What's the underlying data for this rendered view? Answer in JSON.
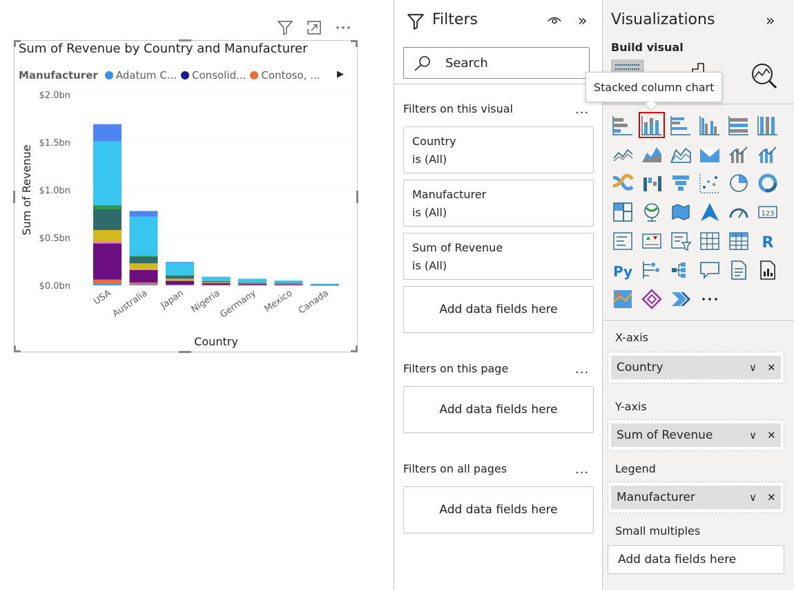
{
  "visual": {
    "title": "Sum of Revenue by Country and Manufacturer",
    "legend_title": "Manufacturer",
    "legend_items": [
      {
        "label": "Adatum C...",
        "color": "#3a8ff0"
      },
      {
        "label": "Consolid...",
        "color": "#1c1a8e"
      },
      {
        "label": "Contoso, ...",
        "color": "#e86c3a"
      }
    ]
  },
  "chart_data": {
    "type": "bar",
    "stacked": true,
    "title": "Sum of Revenue by Country and Manufacturer",
    "xlabel": "Country",
    "ylabel": "Sum of Revenue",
    "categories": [
      "USA",
      "Australia",
      "Japan",
      "Nigeria",
      "Germany",
      "Mexico",
      "Canada"
    ],
    "y_ticks": [
      "$0.0bn",
      "$0.5bn",
      "$1.0bn",
      "$1.5bn",
      "$2.0bn"
    ],
    "ylim": [
      0,
      2.0
    ],
    "units": "bn",
    "grid": true,
    "legend_position": "top-left",
    "series": [
      {
        "name": "Adatum C...",
        "color": "#3a8ff0",
        "values": [
          0.02,
          0.01,
          0.003,
          0.002,
          0.002,
          0.002,
          0.001
        ]
      },
      {
        "name": "",
        "color": "#e86c3a",
        "values": [
          0.04,
          0.02,
          0.005,
          0.003,
          0.003,
          0.003,
          0.001
        ]
      },
      {
        "name": "",
        "color": "#6b0e7f",
        "values": [
          0.38,
          0.13,
          0.04,
          0.02,
          0.015,
          0.01,
          0.002
        ]
      },
      {
        "name": "",
        "color": "#e87ec5",
        "values": [
          0.02,
          0.01,
          0.002,
          0.001,
          0.001,
          0.001,
          0.0
        ]
      },
      {
        "name": "",
        "color": "#d4b81f",
        "values": [
          0.12,
          0.06,
          0.02,
          0.007,
          0.003,
          0.003,
          0.0
        ]
      },
      {
        "name": "",
        "color": "#2f6b6b",
        "values": [
          0.22,
          0.07,
          0.03,
          0.01,
          0.005,
          0.005,
          0.002
        ]
      },
      {
        "name": "",
        "color": "#2c9a3d",
        "values": [
          0.04,
          0.01,
          0.005,
          0.002,
          0.001,
          0.001,
          0.0
        ]
      },
      {
        "name": "",
        "color": "#38c5f0",
        "values": [
          0.67,
          0.41,
          0.13,
          0.04,
          0.04,
          0.025,
          0.01
        ]
      },
      {
        "name": "",
        "color": "#4d86f0",
        "values": [
          0.18,
          0.06,
          0.01,
          0.005,
          0.0,
          0.0,
          0.0
        ]
      }
    ]
  },
  "filters": {
    "title": "Filters",
    "search_placeholder": "Search",
    "visual_section": "Filters on this visual",
    "cards": [
      {
        "name": "Country",
        "state": "is (All)"
      },
      {
        "name": "Manufacturer",
        "state": "is (All)"
      },
      {
        "name": "Sum of Revenue",
        "state": "is (All)"
      }
    ],
    "add_fields": "Add data fields here",
    "page_section": "Filters on this page",
    "all_pages_section": "Filters on all pages",
    "more": "..."
  },
  "visualizations": {
    "title": "Visualizations",
    "build_visual": "Build visual",
    "tooltip": "Stacked column chart",
    "x_axis": {
      "label": "X-axis",
      "field": "Country"
    },
    "y_axis": {
      "label": "Y-axis",
      "field": "Sum of Revenue"
    },
    "legend": {
      "label": "Legend",
      "field": "Manufacturer"
    },
    "small_multiples": {
      "label": "Small multiples",
      "placeholder": "Add data fields here"
    },
    "more_visuals": "..."
  }
}
